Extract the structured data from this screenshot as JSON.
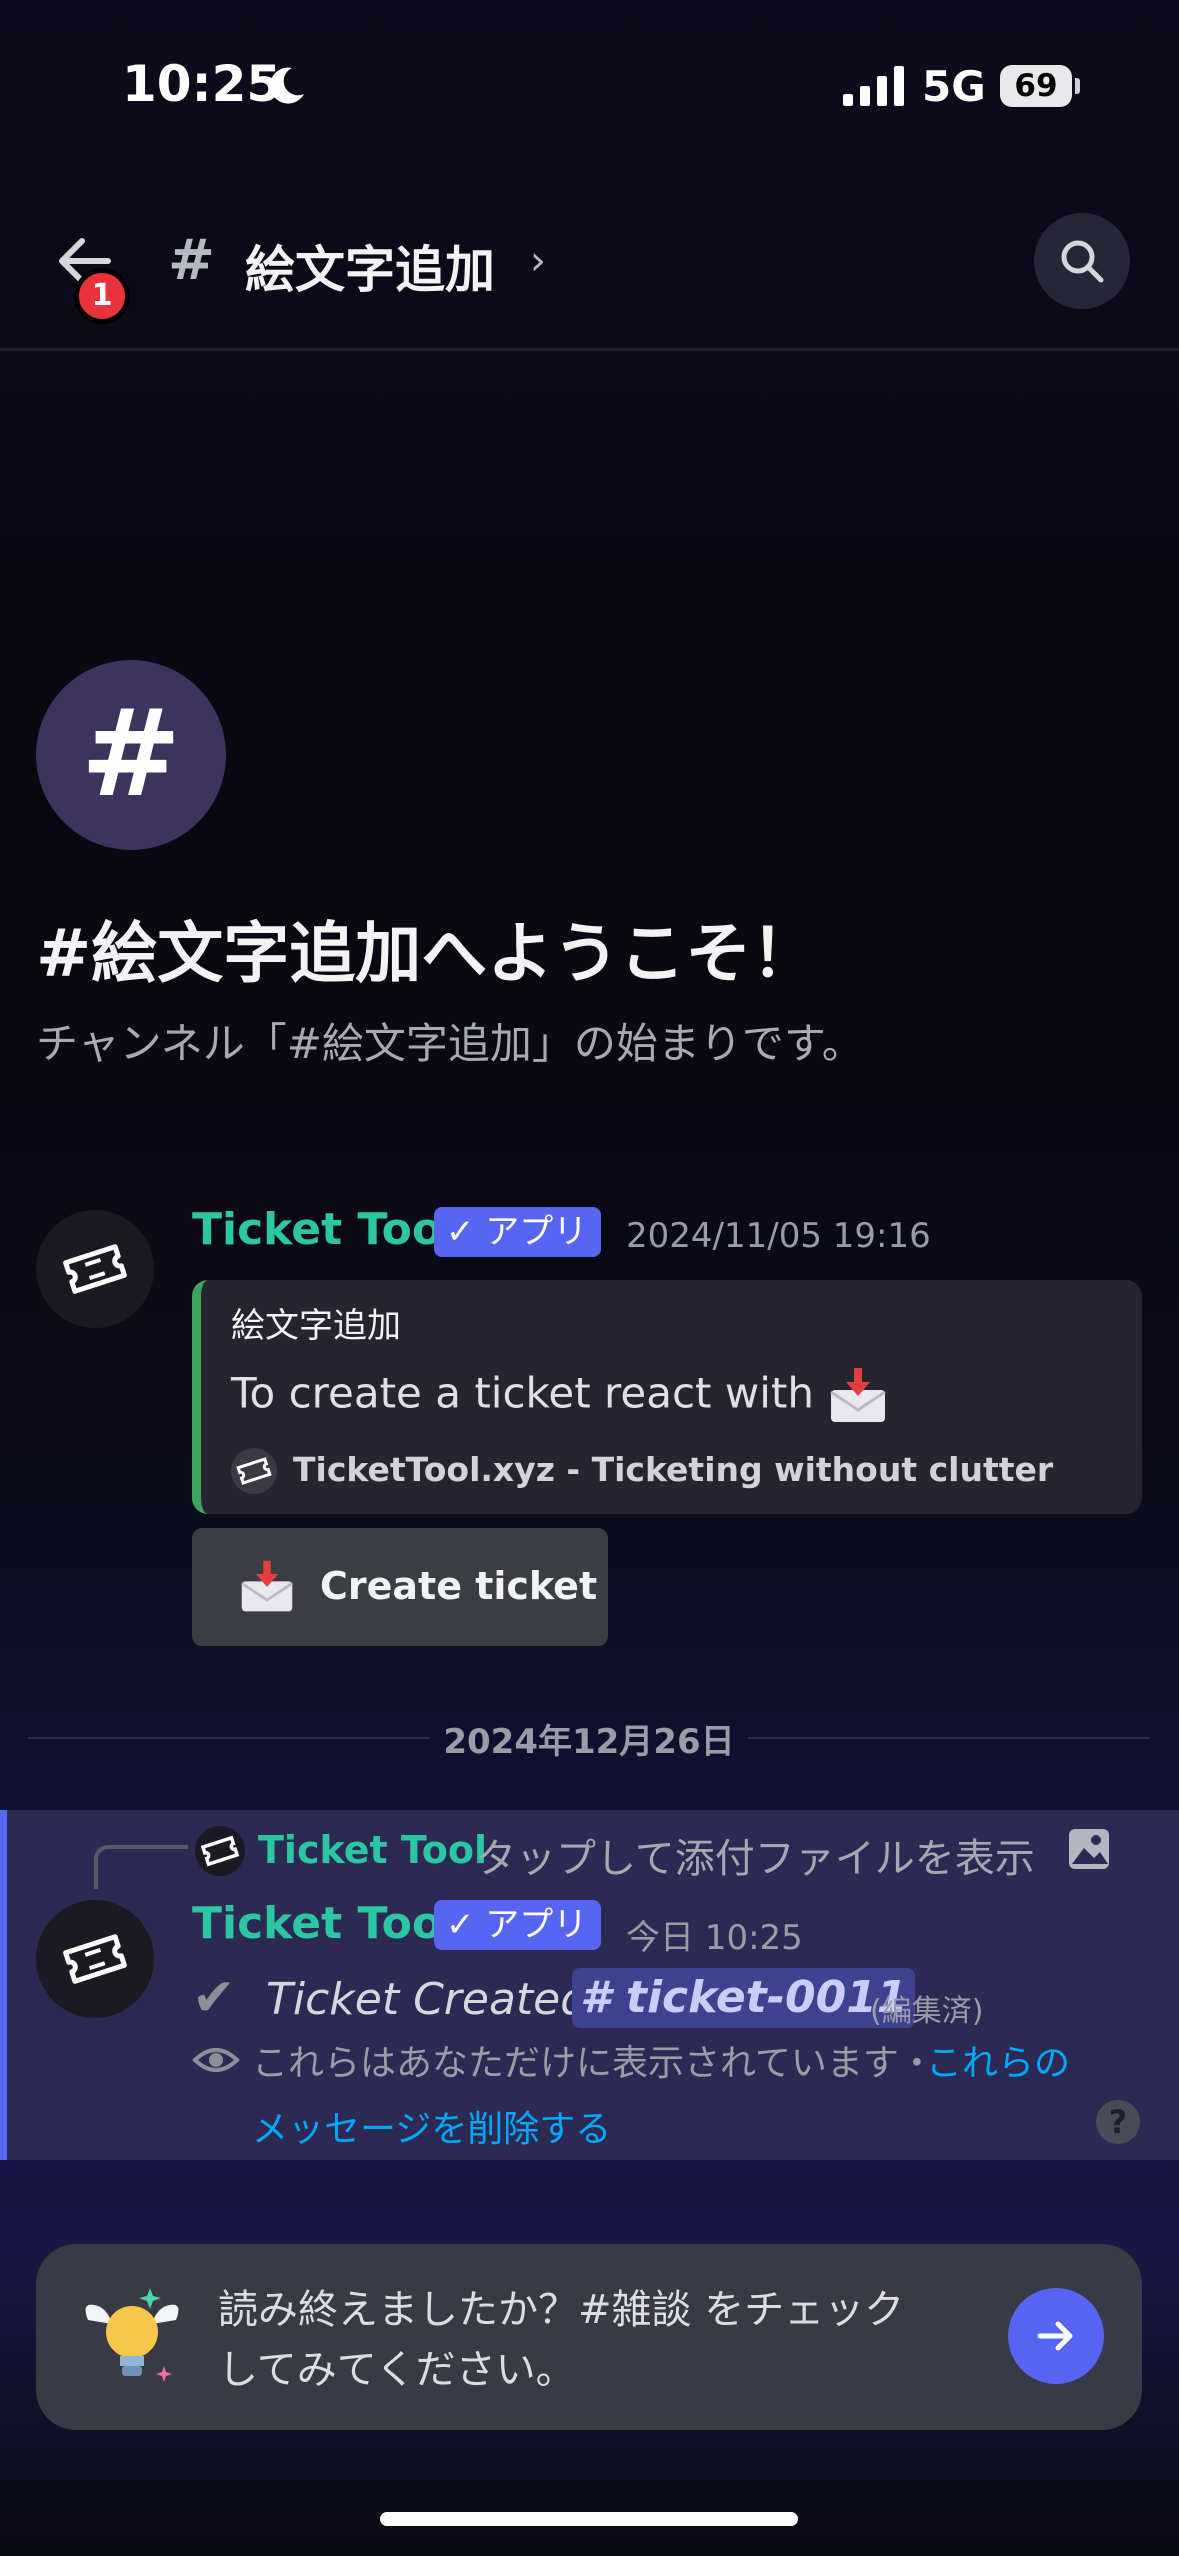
{
  "status_bar": {
    "time": "10:25",
    "network": "5G",
    "battery": "69"
  },
  "header": {
    "badge_count": "1",
    "hash": "#",
    "channel_name": "絵文字追加",
    "chevron": "›"
  },
  "welcome": {
    "hash_glyph": "#",
    "title": "#絵文字追加へようこそ！",
    "subtitle": "チャンネル「#絵文字追加」の始まりです。"
  },
  "message1": {
    "author": "Ticket Tool",
    "app_tag": "アプリ",
    "timestamp": "2024/11/05 19:16",
    "embed": {
      "title": "絵文字追加",
      "description": "To create a ticket react with",
      "footer": "TicketTool.xyz - Ticketing without clutter"
    },
    "button_label": "Create ticket"
  },
  "date_divider": "2024年12月26日",
  "message2": {
    "reply_author": "Ticket Tool",
    "reply_text": "タップして添付ファイルを表示",
    "author": "Ticket Tool",
    "app_tag": "アプリ",
    "timestamp": "今日 10:25",
    "check": "✔",
    "text": "Ticket Created",
    "mention": "# ticket-0011",
    "edited": "(編集済)",
    "ephemeral_note": "これらはあなただけに表示されています・",
    "delete_link_1": "これらの",
    "delete_link_2": "メッセージを削除する",
    "help": "?"
  },
  "prompt": {
    "text": "読み終えましたか？#雑談 をチェックしてみてください。"
  },
  "colors": {
    "accent": "#5865f2",
    "author": "#2bc7a2",
    "link": "#00a8fc",
    "embed_bar": "#3ba55d"
  }
}
